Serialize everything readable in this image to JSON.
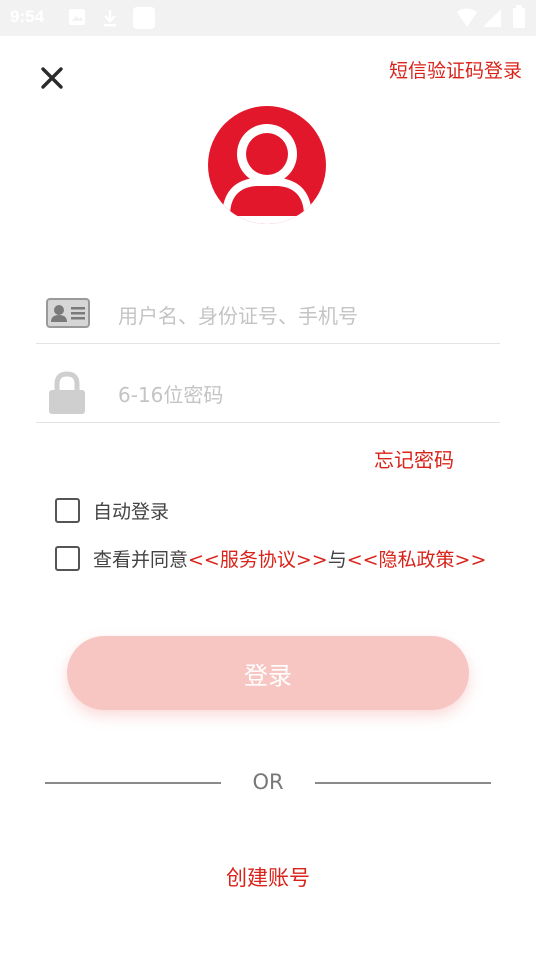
{
  "status_bar": {
    "time": "9:54"
  },
  "header": {
    "sms_login_label": "短信验证码登录"
  },
  "form": {
    "username": {
      "placeholder": "用户名、身份证号、手机号",
      "value": ""
    },
    "password": {
      "placeholder": "6-16位密码",
      "value": ""
    },
    "forgot_label": "忘记密码"
  },
  "options": {
    "auto_login_label": "自动登录",
    "agree_prefix": "查看并同意",
    "service_agreement": "<<服务协议>>",
    "agree_joiner": "与",
    "privacy_policy": "<<隐私政策>>"
  },
  "login_button_label": "登录",
  "divider_label": "OR",
  "create_account_label": "创建账号",
  "colors": {
    "accent": "#d9231a",
    "button_disabled": "#f7c6c3"
  }
}
